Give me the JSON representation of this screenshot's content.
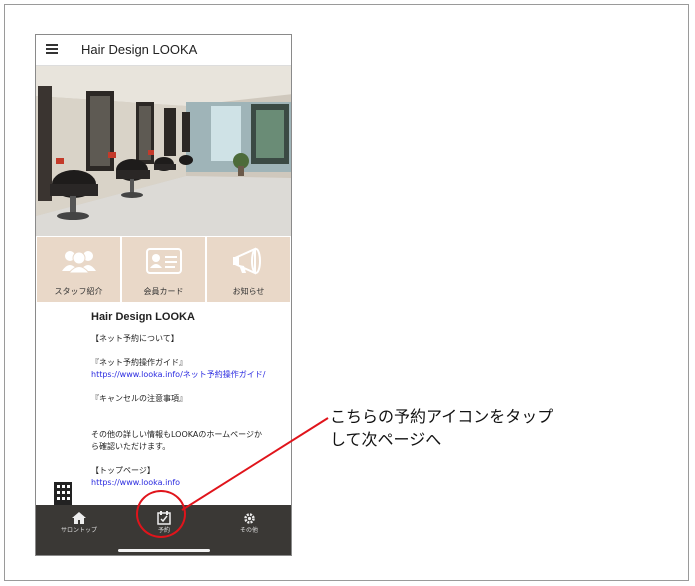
{
  "app": {
    "title": "Hair Design LOOKA"
  },
  "tiles": [
    {
      "label": "スタッフ紹介",
      "icon": "staff-icon"
    },
    {
      "label": "会員カード",
      "icon": "member-card-icon"
    },
    {
      "label": "お知らせ",
      "icon": "megaphone-icon"
    }
  ],
  "content": {
    "shop_name": "Hair Design LOOKA",
    "net_reserve_heading": "【ネット予約について】",
    "guide_heading": "『ネット予約操作ガイド』",
    "guide_link": "https://www.looka.info/ネット予約操作ガイド/",
    "cancel_heading": "『キャンセルの注意事項』",
    "info_line1": "その他の詳しい情報もLOOKAのホームページか",
    "info_line2": "ら確認いただけます。",
    "top_heading": "【トップページ】",
    "top_link": "https://www.looka.info"
  },
  "tabbar": {
    "items": [
      {
        "label": "サロントップ",
        "icon": "home-icon"
      },
      {
        "label": "予約",
        "icon": "calendar-check-icon"
      },
      {
        "label": "その他",
        "icon": "gear-icon"
      }
    ]
  },
  "annotation": {
    "line1": "こちらの予約アイコンをタップ",
    "line2": "して次ページへ",
    "color": "#e0141b"
  }
}
